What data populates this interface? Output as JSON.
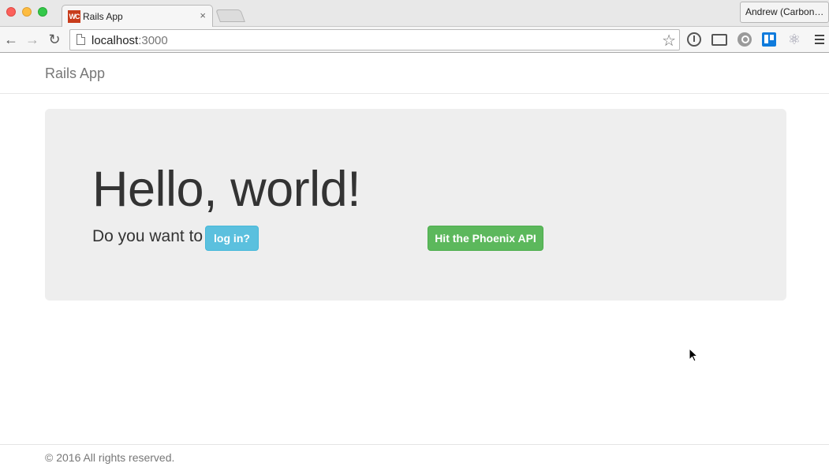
{
  "browser": {
    "tab_title": "Rails App",
    "favicon_text": "WC",
    "tab_close": "×",
    "profile_name": "Andrew (Carbon…",
    "url_host": "localhost",
    "url_port": ":3000",
    "back_icon": "←",
    "forward_icon": "→",
    "reload_icon": "↻",
    "star_icon": "☆",
    "react_icon": "⚛"
  },
  "navbar": {
    "brand": "Rails App"
  },
  "jumbotron": {
    "heading": "Hello, world!",
    "question": "Do you want to",
    "login_button": "log in?",
    "phoenix_button": "Hit the Phoenix API"
  },
  "footer": {
    "text": "© 2016 All rights reserved."
  },
  "colors": {
    "info_button": "#5bc0de",
    "success_button": "#5cb85c",
    "jumbotron_bg": "#eeeeee"
  }
}
